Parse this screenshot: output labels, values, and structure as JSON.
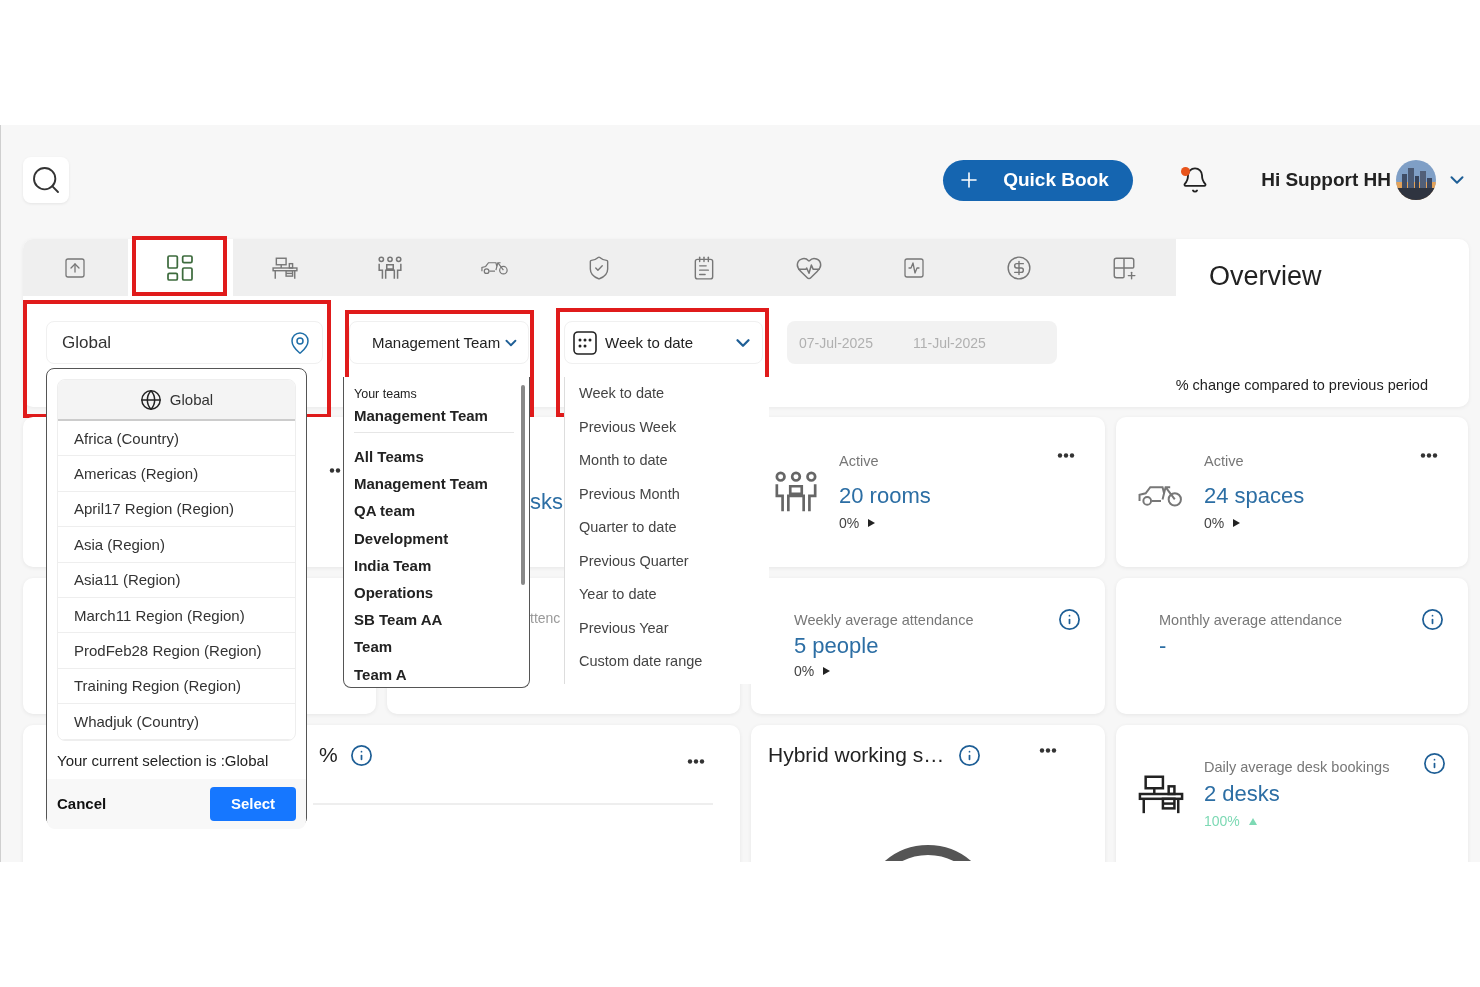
{
  "header": {
    "quick_book": "Quick Book",
    "notifications": {
      "unread": true
    },
    "greeting": "Hi Support HH"
  },
  "tabs": [
    {
      "selected": false,
      "highlighted": false
    },
    {
      "selected": true,
      "highlighted": true
    },
    {
      "selected": false,
      "highlighted": false
    },
    {
      "selected": false,
      "highlighted": false
    },
    {
      "selected": false,
      "highlighted": false
    },
    {
      "selected": false,
      "highlighted": false
    },
    {
      "selected": false,
      "highlighted": false
    },
    {
      "selected": false,
      "highlighted": false
    },
    {
      "selected": false,
      "highlighted": false
    },
    {
      "selected": false,
      "highlighted": false
    },
    {
      "selected": false,
      "highlighted": false
    }
  ],
  "panel_title": "Overview",
  "filters": {
    "location": {
      "value": "Global",
      "highlighted": true
    },
    "team": {
      "value": "Management Team",
      "highlighted": true
    },
    "period": {
      "value": "Week to date",
      "highlighted": true
    },
    "date_range": {
      "start": "07-Jul-2025",
      "end": "11-Jul-2025",
      "disabled": true
    }
  },
  "comparison_note": "% change compared to previous period",
  "cards": [
    {
      "kind": "covered"
    },
    {
      "kind": "fragment",
      "text": "sks"
    },
    {
      "kind": "stat",
      "label": "Active",
      "value": "20 rooms",
      "change": "0%",
      "rising": false
    },
    {
      "kind": "stat",
      "label": "Active",
      "value": "24 spaces",
      "change": "0%",
      "rising": false
    },
    {
      "kind": "blank"
    },
    {
      "kind": "faded",
      "text": "ttenc"
    },
    {
      "kind": "metric",
      "label": "Weekly average attendance",
      "value": "5 people",
      "change": "0%",
      "rising": false
    },
    {
      "kind": "metric",
      "label": "Monthly average attendance",
      "value": "-"
    },
    {
      "kind": "split_title",
      "tail": "%"
    },
    {
      "kind": "title",
      "title": "Hybrid working s…"
    },
    {
      "kind": "info_stat",
      "label": "Daily average desk bookings",
      "value": "2 desks",
      "change": "100%",
      "rising": true
    }
  ],
  "location_menu": {
    "header": "Global",
    "items": [
      "Africa (Country)",
      "Americas (Region)",
      "April17 Region (Region)",
      "Asia (Region)",
      "Asia11 (Region)",
      "March11 Region (Region)",
      "ProdFeb28 Region (Region)",
      "Training Region (Region)",
      "Whadjuk (Country)"
    ],
    "selection_note": "Your current selection is :Global",
    "cancel": "Cancel",
    "select": "Select"
  },
  "team_menu": {
    "section_label": "Your teams",
    "your_teams": [
      "Management Team"
    ],
    "items": [
      "All Teams",
      "Management Team",
      "QA team",
      "Development",
      "India Team",
      "Operations",
      "SB Team AA",
      "Team",
      "Team A"
    ]
  },
  "period_menu": {
    "items": [
      "Week to date",
      "Previous Week",
      "Month to date",
      "Previous Month",
      "Quarter to date",
      "Previous Quarter",
      "Year to date",
      "Previous Year",
      "Custom date range"
    ]
  }
}
